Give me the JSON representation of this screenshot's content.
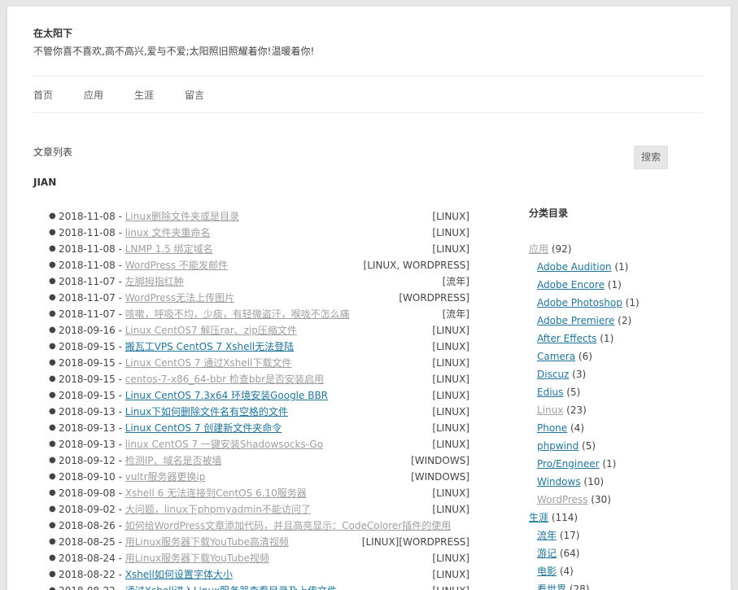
{
  "site": {
    "title": "在太阳下",
    "description": "不管你喜不喜欢,高不高兴,爱与不爱;太阳照旧照耀着你!温暖着你!"
  },
  "nav": {
    "items": [
      {
        "label": "首页"
      },
      {
        "label": "应用"
      },
      {
        "label": "生涯"
      },
      {
        "label": "留言"
      }
    ]
  },
  "main": {
    "heading": "文章列表",
    "author": "JIAN",
    "posts": [
      {
        "date": "2018-11-08",
        "title": "Linux删除文件夹或是目录",
        "category": "[LINUX]",
        "visited": false
      },
      {
        "date": "2018-11-08",
        "title": "linux 文件夹重命名",
        "category": "[LINUX]",
        "visited": false
      },
      {
        "date": "2018-11-08",
        "title": "LNMP 1.5 绑定域名",
        "category": "[LINUX]",
        "visited": false
      },
      {
        "date": "2018-11-08",
        "title": "WordPress 不能发邮件",
        "category": "[LINUX, WORDPRESS]",
        "visited": false
      },
      {
        "date": "2018-11-07",
        "title": "左脚拇指红肿",
        "category": "[流年]",
        "visited": false
      },
      {
        "date": "2018-11-07",
        "title": "WordPress无法上传图片",
        "category": "[WORDPRESS]",
        "visited": false
      },
      {
        "date": "2018-11-07",
        "title": "咳嗽，呼吸不均，少痰，有轻微盗汗，喉咙不怎么痛",
        "category": "[流年]",
        "visited": false
      },
      {
        "date": "2018-09-16",
        "title": "Linux CentOS7 解压rar、zip压缩文件",
        "category": "[LINUX]",
        "visited": false
      },
      {
        "date": "2018-09-15",
        "title": "搬瓦工VPS CentOS 7 Xshell无法登陆",
        "category": "[LINUX]",
        "visited": true
      },
      {
        "date": "2018-09-15",
        "title": "Linux CentOS 7 通过Xshell下载文件",
        "category": "[LINUX]",
        "visited": false
      },
      {
        "date": "2018-09-15",
        "title": "centos-7-x86_64-bbr 检查bbr是否安装启用",
        "category": "[LINUX]",
        "visited": false
      },
      {
        "date": "2018-09-15",
        "title": "Linux CentOS 7.3x64 环境安装Google BBR",
        "category": "[LINUX]",
        "visited": true
      },
      {
        "date": "2018-09-13",
        "title": "Linux下如何删除文件名有空格的文件",
        "category": "[LINUX]",
        "visited": true
      },
      {
        "date": "2018-09-13",
        "title": "Linux CentOS 7 创建新文件夹命令",
        "category": "[LINUX]",
        "visited": true
      },
      {
        "date": "2018-09-13",
        "title": "linux CentOS 7 一键安装Shadowsocks-Go",
        "category": "[LINUX]",
        "visited": false
      },
      {
        "date": "2018-09-12",
        "title": "检测IP、域名是否被墙",
        "category": "[WINDOWS]",
        "visited": false
      },
      {
        "date": "2018-09-10",
        "title": "vultr服务器更换ip",
        "category": "[WINDOWS]",
        "visited": false
      },
      {
        "date": "2018-09-08",
        "title": "Xshell 6 无法连接到CentOS 6.10服务器",
        "category": "[LINUX]",
        "visited": false
      },
      {
        "date": "2018-09-02",
        "title": "大问题，linux下phpmyadmin不能访问了",
        "category": "[LINUX]",
        "visited": false
      },
      {
        "date": "2018-08-26",
        "title": "如何给WordPress文章添加代码，并且高亮显示：CodeColorer插件的使用",
        "category": "",
        "visited": false
      },
      {
        "date": "2018-08-25",
        "title": "用Linux服务器下载YouTube高清视频",
        "category": "[LINUX][WORDPRESS]",
        "visited": false
      },
      {
        "date": "2018-08-24",
        "title": "用Linux服务器下载YouTube视频",
        "category": "[LINUX]",
        "visited": false
      },
      {
        "date": "2018-08-22",
        "title": "Xshell如何设置字体大小",
        "category": "[LINUX]",
        "visited": true
      },
      {
        "date": "2018-08-22",
        "title": "通过Xshell进入Linux服务器查看目录及上传文件",
        "category": "[LINUX]",
        "visited": true
      }
    ]
  },
  "sidebar": {
    "search_label": "搜索",
    "widget_title": "分类目录",
    "categories": [
      {
        "name": "应用",
        "count": "(92)",
        "child": false,
        "gray": true
      },
      {
        "name": "Adobe Audition",
        "count": "(1)",
        "child": true,
        "gray": false
      },
      {
        "name": "Adobe Encore",
        "count": "(1)",
        "child": true,
        "gray": false
      },
      {
        "name": "Adobe Photoshop",
        "count": "(1)",
        "child": true,
        "gray": false
      },
      {
        "name": "Adobe Premiere",
        "count": "(2)",
        "child": true,
        "gray": false
      },
      {
        "name": "After Effects",
        "count": "(1)",
        "child": true,
        "gray": false
      },
      {
        "name": "Camera",
        "count": "(6)",
        "child": true,
        "gray": false
      },
      {
        "name": "Discuz",
        "count": "(3)",
        "child": true,
        "gray": false
      },
      {
        "name": "Edius",
        "count": "(5)",
        "child": true,
        "gray": false
      },
      {
        "name": "Linux",
        "count": "(23)",
        "child": true,
        "gray": true
      },
      {
        "name": "Phone",
        "count": "(4)",
        "child": true,
        "gray": false
      },
      {
        "name": "phpwind",
        "count": "(5)",
        "child": true,
        "gray": false
      },
      {
        "name": "Pro/Engineer",
        "count": "(1)",
        "child": true,
        "gray": false
      },
      {
        "name": "Windows",
        "count": "(10)",
        "child": true,
        "gray": false
      },
      {
        "name": "WordPress",
        "count": "(30)",
        "child": true,
        "gray": true
      },
      {
        "name": "生涯",
        "count": "(114)",
        "child": false,
        "gray": false
      },
      {
        "name": "流年",
        "count": "(17)",
        "child": true,
        "gray": false
      },
      {
        "name": "游记",
        "count": "(64)",
        "child": true,
        "gray": false
      },
      {
        "name": "电影",
        "count": "(4)",
        "child": true,
        "gray": false
      },
      {
        "name": "看世界",
        "count": "(28)",
        "child": true,
        "gray": false
      }
    ]
  }
}
